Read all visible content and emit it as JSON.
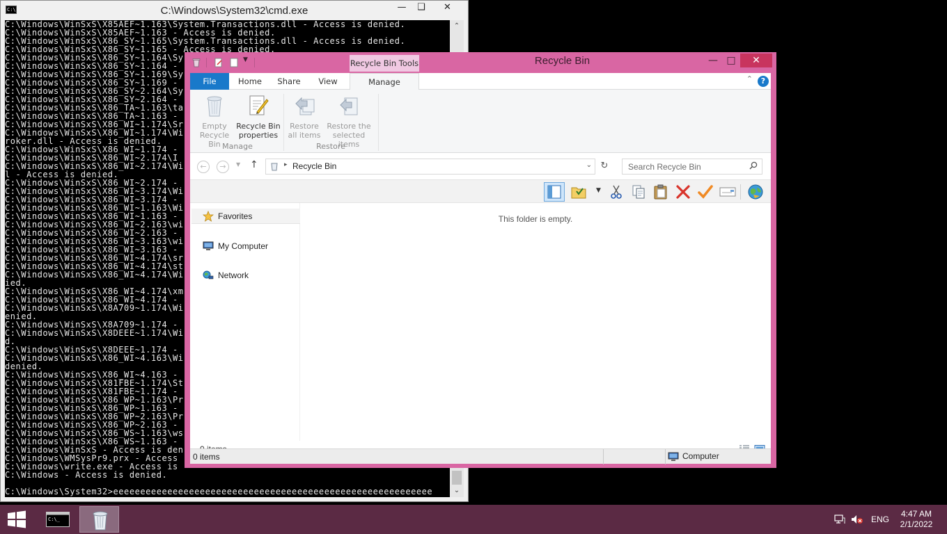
{
  "cmd": {
    "title": "C:\\Windows\\System32\\cmd.exe",
    "output_lines": [
      "C:\\Windows\\WinSxS\\X85AEF~1.163\\System.Transactions.dll - Access is denied.",
      "C:\\Windows\\WinSxS\\X85AEF~1.163 - Access is denied.",
      "C:\\Windows\\WinSxS\\X86_SY~1.165\\System.Transactions.dll - Access is denied.",
      "C:\\Windows\\WinSxS\\X86_SY~1.165 - Access is denied.",
      "C:\\Windows\\WinSxS\\X86_SY~1.164\\Sy",
      "C:\\Windows\\WinSxS\\X86_SY~1.164 - ",
      "C:\\Windows\\WinSxS\\X86_SY~1.169\\Sy",
      "C:\\Windows\\WinSxS\\X86_SY~1.169 - ",
      "C:\\Windows\\WinSxS\\X86_SY~2.164\\Sy",
      "C:\\Windows\\WinSxS\\X86_SY~2.164 - ",
      "C:\\Windows\\WinSxS\\X86_TA~1.163\\ta",
      "C:\\Windows\\WinSxS\\X86_TA~1.163 - ",
      "C:\\Windows\\WinSxS\\X86_WI~1.174\\Sr",
      "C:\\Windows\\WinSxS\\X86_WI~1.174\\Wi",
      "roker.dll - Access is denied.",
      "C:\\Windows\\WinSxS\\X86_WI~1.174 - ",
      "C:\\Windows\\WinSxS\\X86_WI~2.174\\I",
      "C:\\Windows\\WinSxS\\X86_WI~2.174\\Wi",
      "l - Access is denied.",
      "C:\\Windows\\WinSxS\\X86_WI~2.174 - ",
      "C:\\Windows\\WinSxS\\X86_WI~3.174\\Wi",
      "C:\\Windows\\WinSxS\\X86_WI~3.174 - ",
      "C:\\Windows\\WinSxS\\X86_WI~1.163\\Wi",
      "C:\\Windows\\WinSxS\\X86_WI~1.163 - ",
      "C:\\Windows\\WinSxS\\X86_WI~2.163\\wi",
      "C:\\Windows\\WinSxS\\X86_WI~2.163 - ",
      "C:\\Windows\\WinSxS\\X86_WI~3.163\\wi",
      "C:\\Windows\\WinSxS\\X86_WI~3.163 - ",
      "C:\\Windows\\WinSxS\\X86_WI~4.174\\sr",
      "C:\\Windows\\WinSxS\\X86_WI~4.174\\st",
      "C:\\Windows\\WinSxS\\X86_WI~4.174\\Wi",
      "ied.",
      "C:\\Windows\\WinSxS\\X86_WI~4.174\\xm",
      "C:\\Windows\\WinSxS\\X86_WI~4.174 - ",
      "C:\\Windows\\WinSxS\\X8A709~1.174\\Wi",
      "enied.",
      "C:\\Windows\\WinSxS\\X8A709~1.174 - ",
      "C:\\Windows\\WinSxS\\X8DEEE~1.174\\Wi",
      "d.",
      "C:\\Windows\\WinSxS\\X8DEEE~1.174 - ",
      "C:\\Windows\\WinSxS\\X86_WI~4.163\\Wi",
      "denied.",
      "C:\\Windows\\WinSxS\\X86_WI~4.163 - ",
      "C:\\Windows\\WinSxS\\X81FBE~1.174\\St",
      "C:\\Windows\\WinSxS\\X81FBE~1.174 - ",
      "C:\\Windows\\WinSxS\\X86_WP~1.163\\Pr",
      "C:\\Windows\\WinSxS\\X86_WP~1.163 - ",
      "C:\\Windows\\WinSxS\\X86_WP~2.163\\Pr",
      "C:\\Windows\\WinSxS\\X86_WP~2.163 - ",
      "C:\\Windows\\WinSxS\\X86_WS~1.163\\ws",
      "C:\\Windows\\WinSxS\\X86_WS~1.163 - ",
      "C:\\Windows\\WinSxS - Access is den",
      "C:\\Windows\\WMSysPr9.prx - Access ",
      "C:\\Windows\\write.exe - Access is ",
      "C:\\Windows - Access is denied."
    ],
    "prompt": "C:\\Windows\\System32>eeeeeeeeeeeeeeeeeeeeeeeeeeeeeeeeeeeeeeeeeeeeeeeeeeeeeeeeeee"
  },
  "explorer": {
    "title": "Recycle Bin",
    "context_tab": "Recycle Bin Tools",
    "accent_color": "#d966a3",
    "tabs": {
      "file": "File",
      "home": "Home",
      "share": "Share",
      "view": "View",
      "manage": "Manage"
    },
    "ribbon": {
      "empty_l1": "Empty",
      "empty_l2": "Recycle Bin",
      "props_l1": "Recycle Bin",
      "props_l2": "properties",
      "restore_all_l1": "Restore",
      "restore_all_l2": "all items",
      "restore_sel_l1": "Restore the",
      "restore_sel_l2": "selected items",
      "group_manage": "Manage",
      "group_restore": "Restore"
    },
    "address": {
      "location": "Recycle Bin",
      "search_placeholder": "Search Recycle Bin"
    },
    "nav": {
      "favorites": "Favorites",
      "my_computer": "My Computer",
      "network": "Network"
    },
    "content": {
      "empty_message": "This folder is empty."
    },
    "status": {
      "count": "0 items",
      "bar_count": "0 items",
      "zone": "Computer"
    }
  },
  "taskbar": {
    "language": "ENG",
    "time": "4:47 AM",
    "date": "2/1/2022",
    "bg_color": "#5b2a44"
  }
}
